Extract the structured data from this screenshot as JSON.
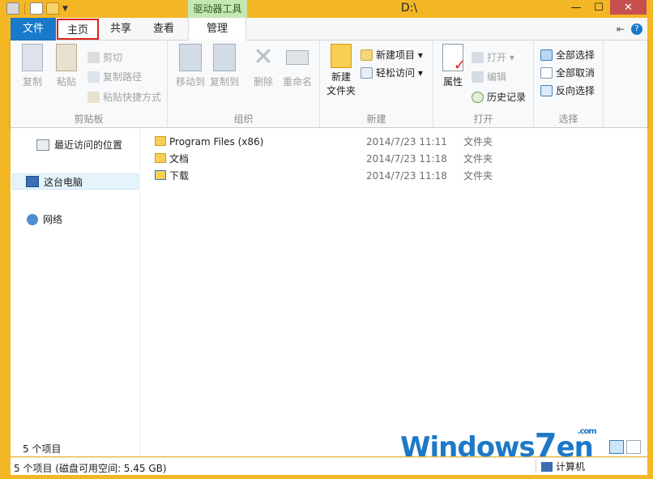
{
  "window": {
    "title": "D:\\",
    "context_tab": "驱动器工具",
    "minimize": "—",
    "maximize": "☐",
    "close": "✕"
  },
  "tabs": {
    "file": "文件",
    "home": "主页",
    "share": "共享",
    "view": "查看",
    "manage": "管理"
  },
  "ribbon": {
    "clipboard": {
      "label": "剪贴板",
      "copy": "复制",
      "paste": "粘贴",
      "cut": "剪切",
      "copy_path": "复制路径",
      "paste_shortcut": "粘贴快捷方式"
    },
    "organize": {
      "label": "组织",
      "move_to": "移动到",
      "copy_to": "复制到",
      "delete": "删除",
      "rename": "重命名"
    },
    "new": {
      "label": "新建",
      "new_folder_line1": "新建",
      "new_folder_line2": "文件夹",
      "new_item": "新建项目 ▾",
      "easy_access": "轻松访问 ▾"
    },
    "open": {
      "label": "打开",
      "properties": "属性",
      "open": "打开 ▾",
      "edit": "编辑",
      "history": "历史记录"
    },
    "select": {
      "label": "选择",
      "select_all": "全部选择",
      "select_none": "全部取消",
      "invert": "反向选择"
    }
  },
  "nav": {
    "recent": "最近访问的位置",
    "this_pc": "这台电脑",
    "network": "网络"
  },
  "files": [
    {
      "name": "Program Files (x86)",
      "date": "2014/7/23 11:11",
      "type": "文件夹"
    },
    {
      "name": "文档",
      "date": "2014/7/23 11:18",
      "type": "文件夹"
    },
    {
      "name": "下载",
      "date": "2014/7/23 11:18",
      "type": "文件夹"
    }
  ],
  "status": {
    "count": "5 个项目",
    "bottom_info": "5 个项目 (磁盘可用空间: 5.45 GB)",
    "computer": "计算机"
  },
  "watermark": {
    "text_a": "Windows",
    "text_b": "7",
    "text_c": "en",
    "suffix": ".com"
  },
  "colors": {
    "accent": "#1979ca",
    "frame": "#f3b726",
    "highlight": "#d9241a"
  }
}
